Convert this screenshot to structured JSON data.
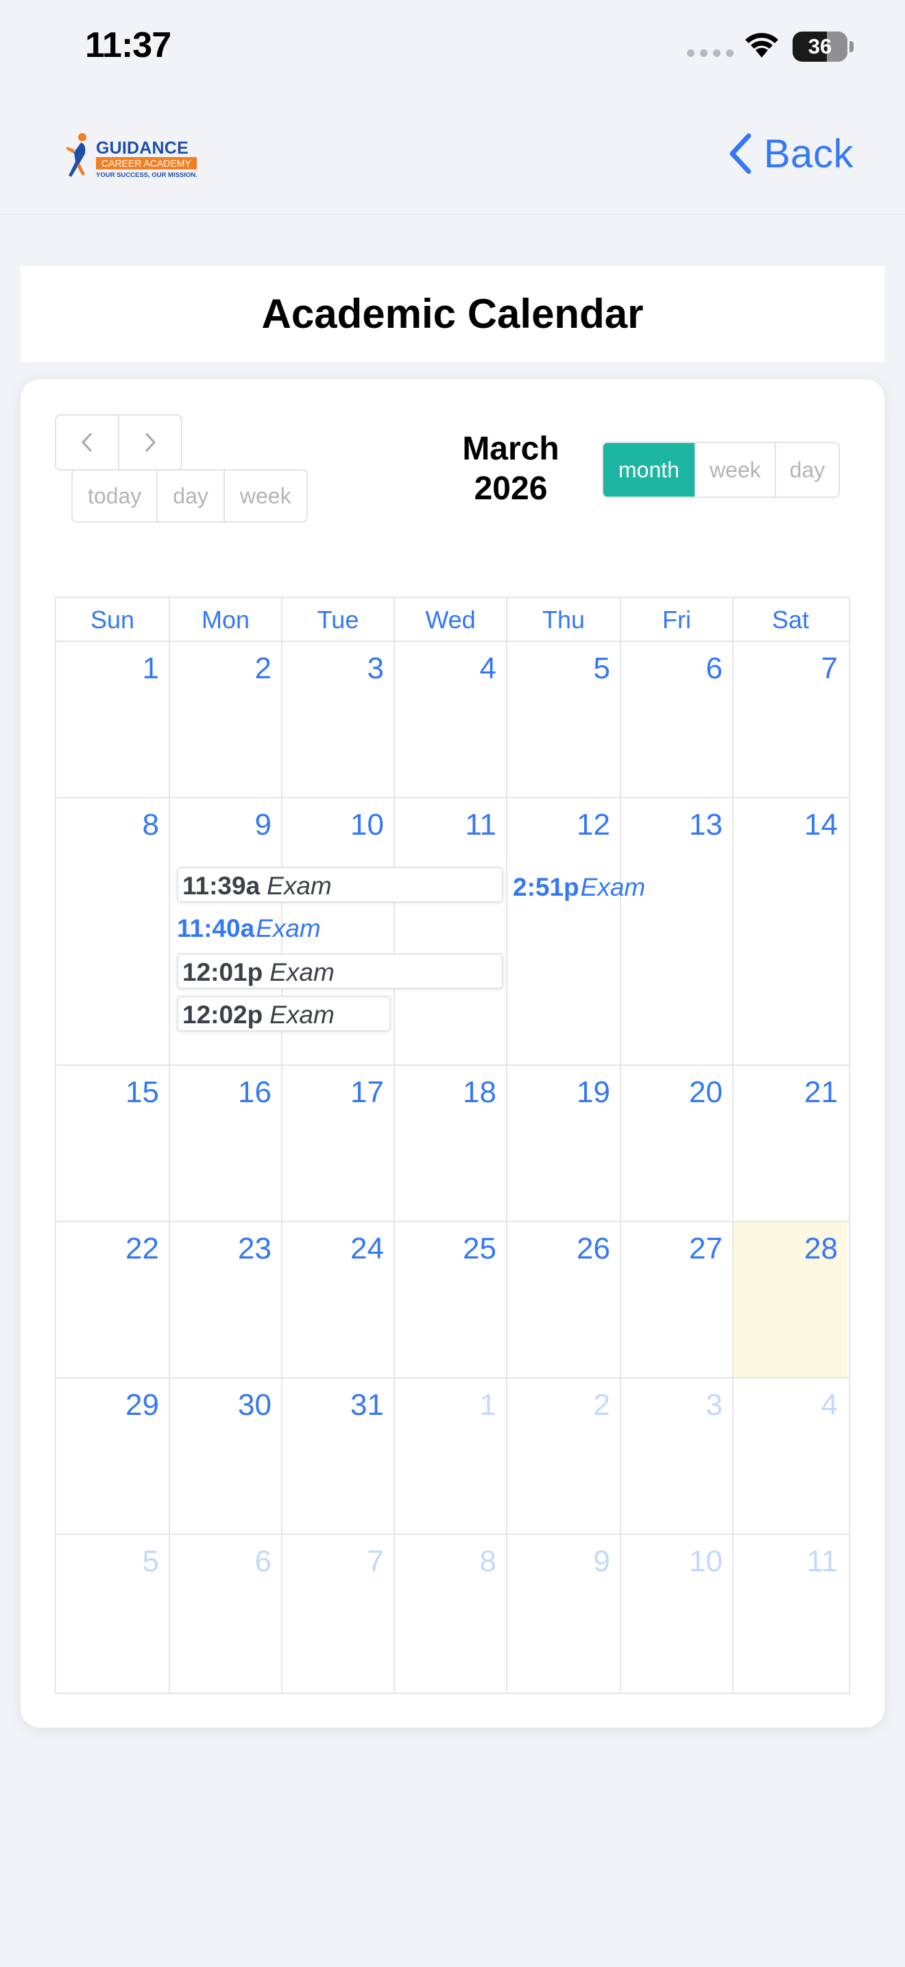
{
  "status_bar": {
    "time": "11:37",
    "battery": "36"
  },
  "header": {
    "logo": {
      "title": "GUIDANCE",
      "subtitle": "CAREER ACADEMY",
      "tagline": "YOUR SUCCESS, OUR MISSION."
    },
    "back_label": "Back"
  },
  "page_title": "Academic Calendar",
  "calendar": {
    "title_month": "March",
    "title_year": "2026",
    "nav": {
      "prev_icon": "chevron-left-icon",
      "next_icon": "chevron-right-icon"
    },
    "secondary_buttons": [
      "today",
      "day",
      "week"
    ],
    "view_buttons": [
      "month",
      "week",
      "day"
    ],
    "active_view": "month",
    "day_headers": [
      "Sun",
      "Mon",
      "Tue",
      "Wed",
      "Thu",
      "Fri",
      "Sat"
    ],
    "weeks": [
      [
        "1",
        "2",
        "3",
        "4",
        "5",
        "6",
        "7"
      ],
      [
        "8",
        "9",
        "10",
        "11",
        "12",
        "13",
        "14"
      ],
      [
        "15",
        "16",
        "17",
        "18",
        "19",
        "20",
        "21"
      ],
      [
        "22",
        "23",
        "24",
        "25",
        "26",
        "27",
        "28"
      ],
      [
        "29",
        "30",
        "31",
        "1",
        "2",
        "3",
        "4"
      ],
      [
        "5",
        "6",
        "7",
        "8",
        "9",
        "10",
        "11"
      ]
    ],
    "highlighted_date": "28",
    "events": [
      {
        "time": "11:39a",
        "title": "Exam"
      },
      {
        "time": "11:40a",
        "title": "Exam"
      },
      {
        "time": "12:01p",
        "title": "Exam"
      },
      {
        "time": "12:02p",
        "title": "Exam"
      },
      {
        "time": "2:51p",
        "title": "Exam"
      }
    ]
  },
  "colors": {
    "accent": "#3478f6",
    "active_view_bg": "#1bb5a2",
    "today_bg": "#fdf8e2",
    "logo_blue": "#1e4fa8",
    "logo_orange": "#f07f22"
  }
}
